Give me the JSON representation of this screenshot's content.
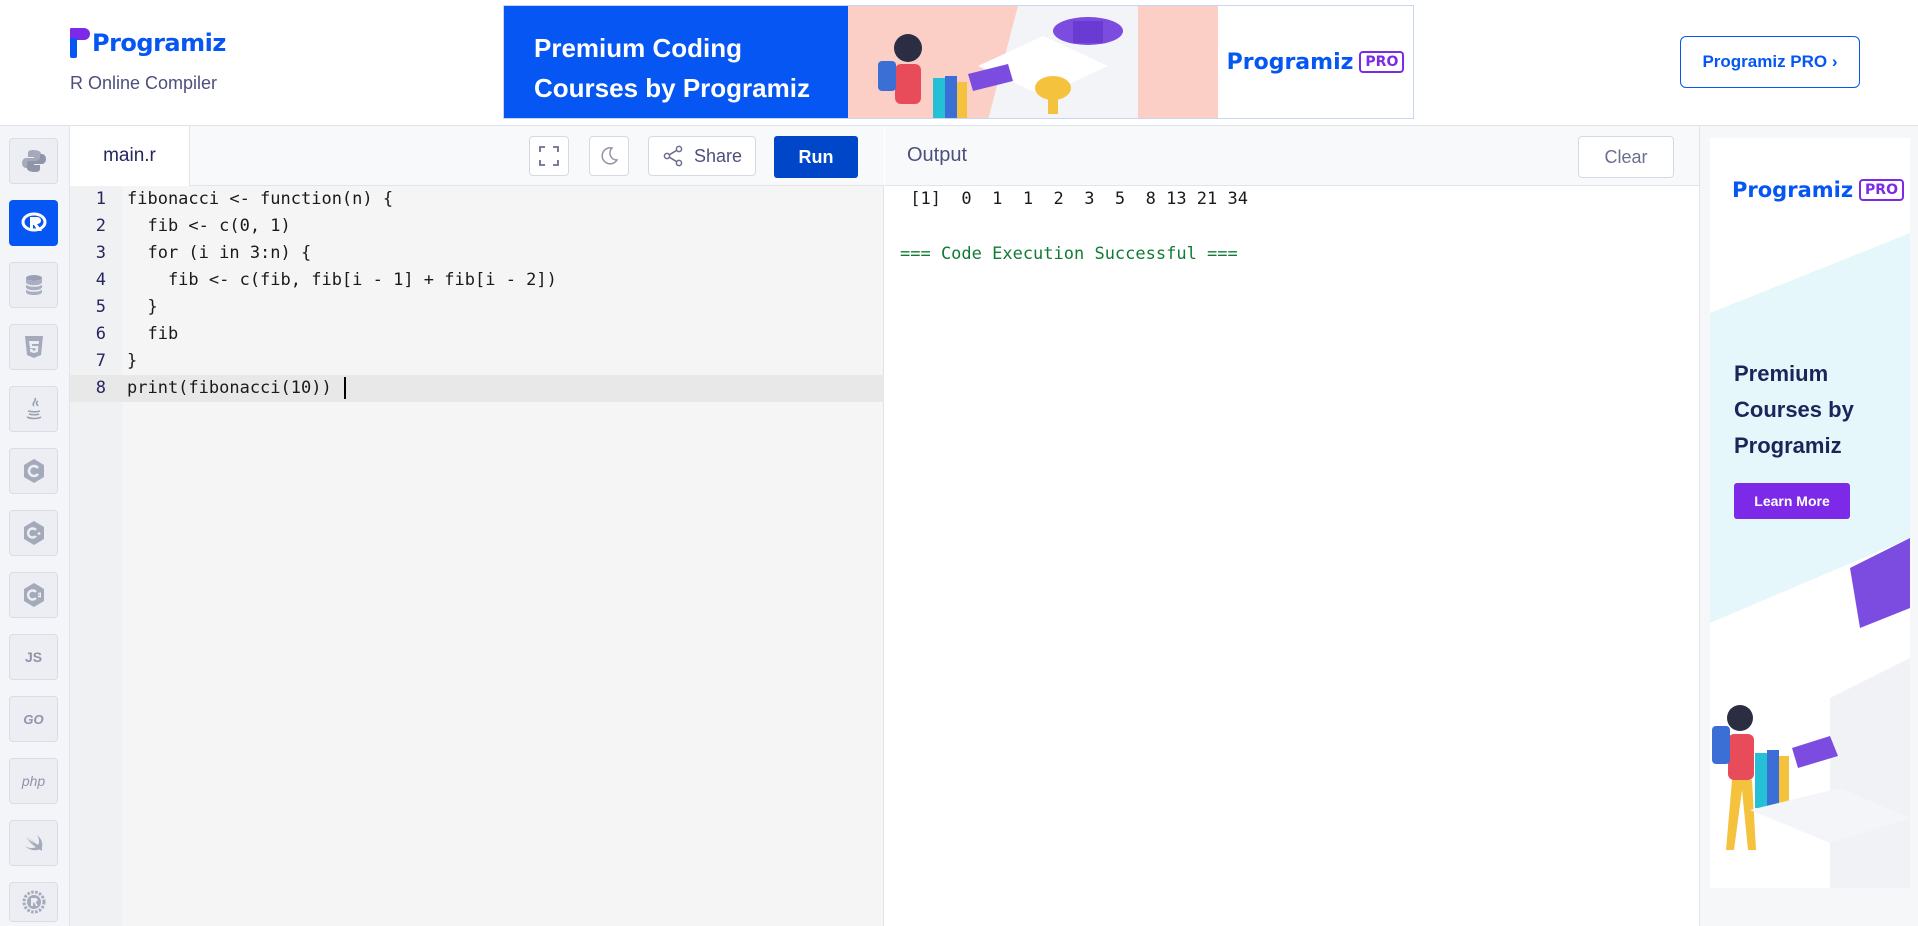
{
  "header": {
    "logo_text": "Programiz",
    "subtitle": "R Online Compiler",
    "banner": {
      "headline_line1": "Premium Coding",
      "headline_line2": "Courses by Programiz",
      "logo_text": "Programiz",
      "badge": "PRO"
    },
    "pro_button_label": "Programiz PRO ›"
  },
  "sidebar": {
    "items": [
      {
        "name": "python",
        "icon": "python-icon",
        "active": false
      },
      {
        "name": "r",
        "icon": "r-icon",
        "active": true
      },
      {
        "name": "sql",
        "icon": "database-icon",
        "active": false
      },
      {
        "name": "html",
        "icon": "html5-icon",
        "active": false
      },
      {
        "name": "java",
        "icon": "java-icon",
        "active": false
      },
      {
        "name": "c",
        "icon": "c-icon",
        "active": false
      },
      {
        "name": "cpp",
        "icon": "cpp-icon",
        "active": false
      },
      {
        "name": "csharp",
        "icon": "csharp-icon",
        "active": false
      },
      {
        "name": "js",
        "icon": "js-icon",
        "label": "JS",
        "active": false
      },
      {
        "name": "go",
        "icon": "go-icon",
        "label": "GO",
        "active": false
      },
      {
        "name": "php",
        "icon": "php-icon",
        "label": "php",
        "active": false
      },
      {
        "name": "swift",
        "icon": "swift-icon",
        "active": false
      },
      {
        "name": "rust",
        "icon": "rust-icon",
        "active": false
      }
    ]
  },
  "editor": {
    "tab_label": "main.r",
    "share_label": "Share",
    "run_label": "Run",
    "current_line": 8,
    "lines": [
      {
        "n": "1",
        "code": "fibonacci <- function(n) {"
      },
      {
        "n": "2",
        "code": "  fib <- c(0, 1)"
      },
      {
        "n": "3",
        "code": "  for (i in 3:n) {"
      },
      {
        "n": "4",
        "code": "    fib <- c(fib, fib[i - 1] + fib[i - 2])"
      },
      {
        "n": "5",
        "code": "  }"
      },
      {
        "n": "6",
        "code": "  fib"
      },
      {
        "n": "7",
        "code": "}"
      },
      {
        "n": "8",
        "code": "print(fibonacci(10)) "
      }
    ]
  },
  "output": {
    "title": "Output",
    "clear_label": "Clear",
    "result_line": " [1]  0  1  1  2  3  5  8 13 21 34",
    "status_line": "=== Code Execution Successful ==="
  },
  "side_ad": {
    "logo_text": "Programiz",
    "badge": "PRO",
    "headline": "Premium Courses by Programiz",
    "button_label": "Learn More"
  },
  "colors": {
    "brand_blue": "#0556f3",
    "brand_purple": "#7d2ae8",
    "run_button": "#0046c9",
    "success_text": "#137a35"
  }
}
